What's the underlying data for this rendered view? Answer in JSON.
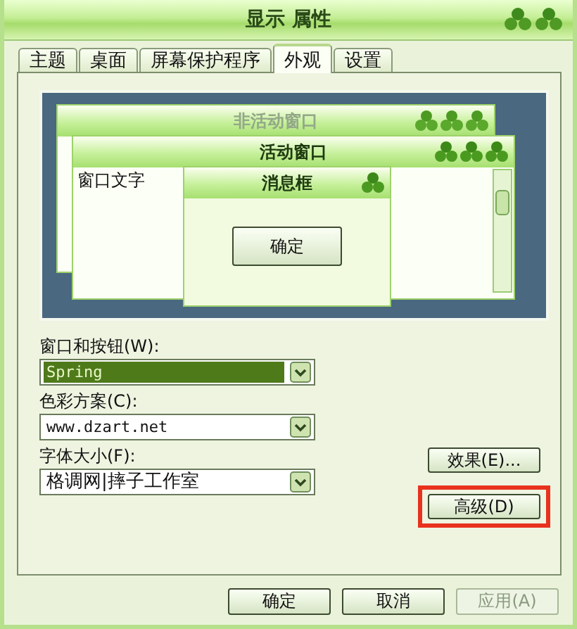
{
  "window": {
    "title": "显示 属性"
  },
  "tabs": [
    {
      "label": "主题",
      "selected": false
    },
    {
      "label": "桌面",
      "selected": false
    },
    {
      "label": "屏幕保护程序",
      "selected": false
    },
    {
      "label": "外观",
      "selected": true
    },
    {
      "label": "设置",
      "selected": false
    }
  ],
  "preview": {
    "inactive_window": {
      "title": "非活动窗口"
    },
    "active_window": {
      "title": "活动窗口",
      "text": "窗口文字"
    },
    "message_box": {
      "title": "消息框",
      "button": "确定"
    }
  },
  "fields": [
    {
      "label": "窗口和按钮(W):",
      "value": "Spring",
      "highlighted": true,
      "kind": "mono"
    },
    {
      "label": "色彩方案(C):",
      "value": "www.dzart.net",
      "highlighted": false,
      "kind": "mono"
    },
    {
      "label": "字体大小(F):",
      "value": "格调网|摔子工作室",
      "highlighted": false,
      "kind": "sans"
    }
  ],
  "side_buttons": [
    {
      "label": "效果(E)...",
      "outlined": false
    },
    {
      "label": "高级(D)",
      "outlined": true
    }
  ],
  "buttons": [
    {
      "label": "确定",
      "disabled": false
    },
    {
      "label": "取消",
      "disabled": false
    },
    {
      "label": "应用(A)",
      "disabled": true
    }
  ]
}
